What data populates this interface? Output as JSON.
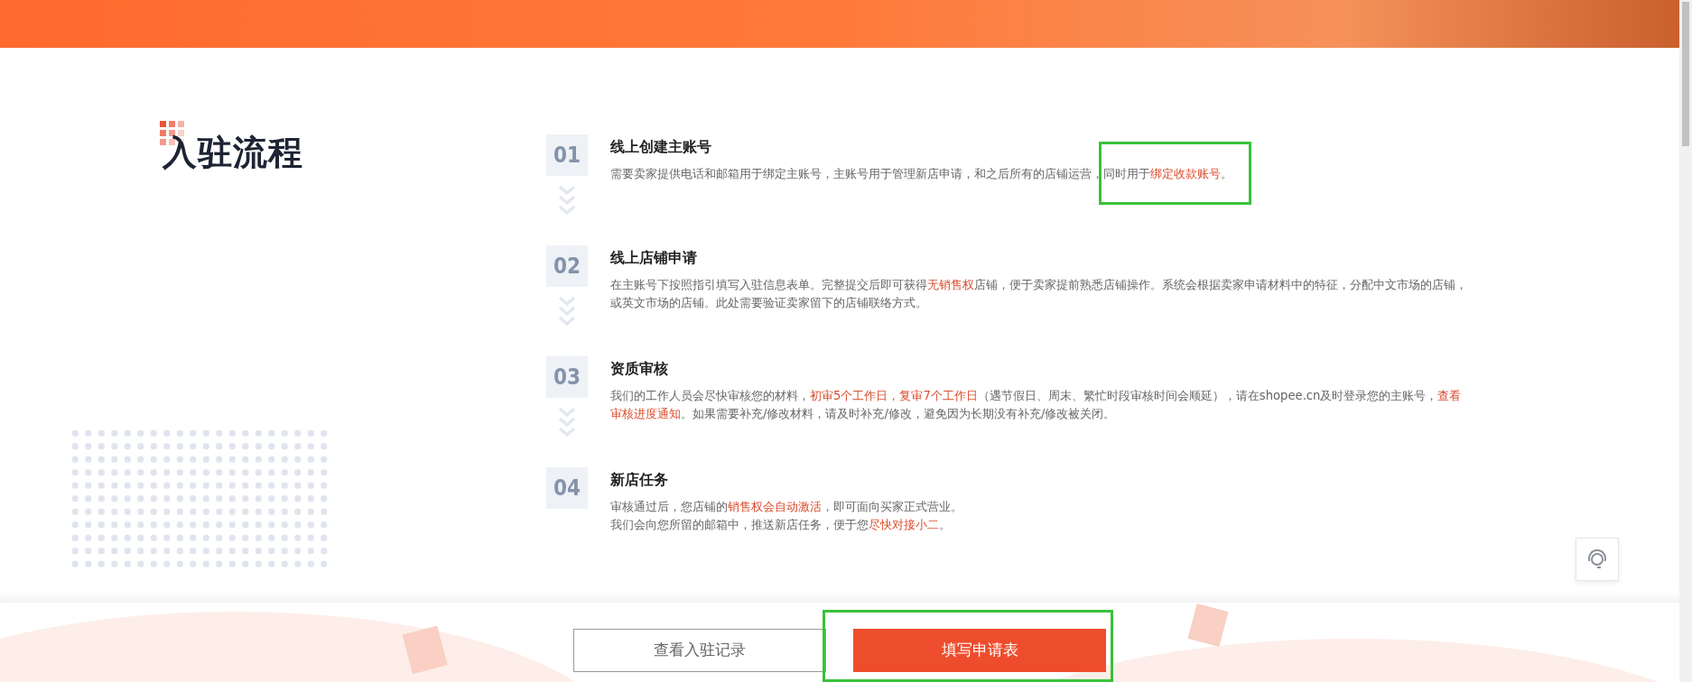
{
  "section_title": "入驻流程",
  "steps": [
    {
      "number": "01",
      "title": "线上创建主账号",
      "lines": [
        [
          {
            "text": "需要卖家提供电话和邮箱用于绑定主账号，主账号用于管理新店申请，和之后所有的店铺运营，同时用于",
            "highlight": false
          },
          {
            "text": "绑定收款账号",
            "highlight": true
          },
          {
            "text": "。",
            "highlight": false
          }
        ]
      ]
    },
    {
      "number": "02",
      "title": "线上店铺申请",
      "lines": [
        [
          {
            "text": "在主账号下按照指引填写入驻信息表单。完整提交后即可获得",
            "highlight": false
          },
          {
            "text": "无销售权",
            "highlight": true
          },
          {
            "text": "店铺，便于卖家提前熟悉店铺操作。系统会根据卖家申请材料中的特征，分配中文市场的店铺，或英文市场的店铺。此处需要验证卖家留下的店铺联络方式。",
            "highlight": false
          }
        ]
      ]
    },
    {
      "number": "03",
      "title": "资质审核",
      "lines": [
        [
          {
            "text": "我们的工作人员会尽快审核您的材料，",
            "highlight": false
          },
          {
            "text": "初审5个工作日，复审7个工作日",
            "highlight": true
          },
          {
            "text": "（遇节假日、周末、繁忙时段审核时间会顺延），请在shopee.cn及时登录您的主账号，",
            "highlight": false
          },
          {
            "text": "查看审核进度通知",
            "highlight": true
          },
          {
            "text": "。如果需要补充/修改材料，请及时补充/修改，避免因为长期没有补充/修改被关闭。",
            "highlight": false
          }
        ]
      ]
    },
    {
      "number": "04",
      "title": "新店任务",
      "lines": [
        [
          {
            "text": "审核通过后，您店铺的",
            "highlight": false
          },
          {
            "text": "销售权会自动激活",
            "highlight": true
          },
          {
            "text": "，即可面向买家正式营业。",
            "highlight": false
          }
        ],
        [
          {
            "text": "我们会向您所留的邮箱中，推送新店任务，便于您",
            "highlight": false
          },
          {
            "text": "尽快对接小二",
            "highlight": true
          },
          {
            "text": "。",
            "highlight": false
          }
        ]
      ]
    }
  ],
  "buttons": [
    {
      "label": "查看入驻记录",
      "kind": "outline"
    },
    {
      "label": "填写申请表",
      "kind": "primary"
    }
  ]
}
